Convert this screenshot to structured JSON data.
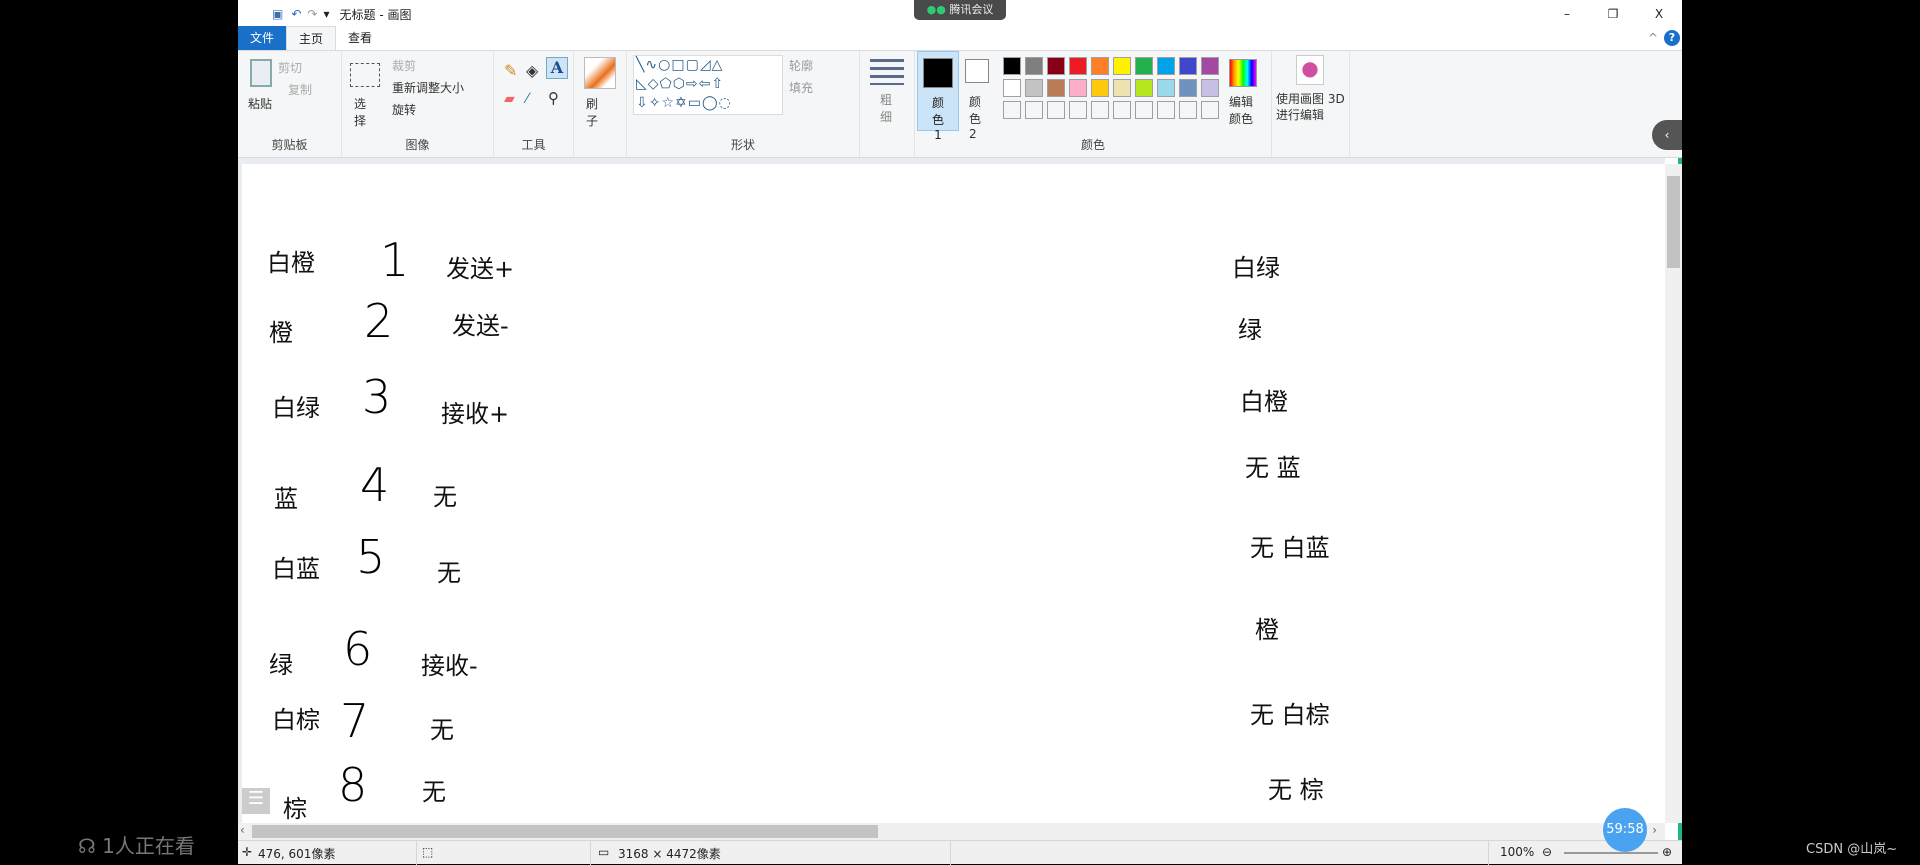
{
  "window": {
    "title": "无标题 - 画图",
    "minimize": "–",
    "restore": "❐",
    "close": "X",
    "help": "?",
    "collapse": "^"
  },
  "meeting_tag": "腾讯会议",
  "tabs": [
    {
      "label": "文件"
    },
    {
      "label": "主页"
    },
    {
      "label": "查看"
    }
  ],
  "ribbon": {
    "clipboard": {
      "label": "剪贴板",
      "paste": "粘贴",
      "cut": "剪切",
      "copy": "复制"
    },
    "image": {
      "label": "图像",
      "select": "选择",
      "crop": "裁剪",
      "resize": "重新调整大小",
      "rotate": "旋转"
    },
    "tools": {
      "label": "工具"
    },
    "brush": {
      "label": "刷子"
    },
    "shapes": {
      "label": "形状",
      "outline": "轮廓",
      "fill": "填充"
    },
    "size": {
      "label": "粗细"
    },
    "colors": {
      "label": "颜色",
      "color1": "颜色 1",
      "color2": "颜色 2",
      "edit": "编辑颜色",
      "palette_row1": [
        "#000000",
        "#7f7f7f",
        "#880015",
        "#ed1c24",
        "#ff7f27",
        "#fff200",
        "#22b14c",
        "#00a2e8",
        "#3f48cc",
        "#a349a4"
      ],
      "palette_row2": [
        "#ffffff",
        "#c3c3c3",
        "#b97a57",
        "#ffaec9",
        "#ffc90e",
        "#efe4b0",
        "#b5e61d",
        "#99d9ea",
        "#7092be",
        "#c8bfe7"
      ]
    },
    "paint3d": {
      "label": "使用画图 3D 进行编辑"
    }
  },
  "canvas": {
    "left": [
      {
        "color": "白橙",
        "num": "1",
        "func": "发送+"
      },
      {
        "color": "橙",
        "num": "2",
        "func": "发送-"
      },
      {
        "color": "白绿",
        "num": "3",
        "func": "接收+"
      },
      {
        "color": "蓝",
        "num": "4",
        "func": "无"
      },
      {
        "color": "白蓝",
        "num": "5",
        "func": "无"
      },
      {
        "color": "绿",
        "num": "6",
        "func": "接收-"
      },
      {
        "color": "白棕",
        "num": "7",
        "func": "无"
      },
      {
        "color": "棕",
        "num": "8",
        "func": "无"
      }
    ],
    "right": [
      "白绿",
      "绿",
      "白橙",
      "无 蓝",
      "无 白蓝",
      "橙",
      "无 白棕",
      "无 棕"
    ]
  },
  "status": {
    "cursor": "476, 601像素",
    "size": "3168 × 4472像素",
    "zoom": "100%"
  },
  "overlay": {
    "viewers": "1人正在看",
    "timer": "59:58",
    "watermark": "CSDN @山岚~"
  }
}
